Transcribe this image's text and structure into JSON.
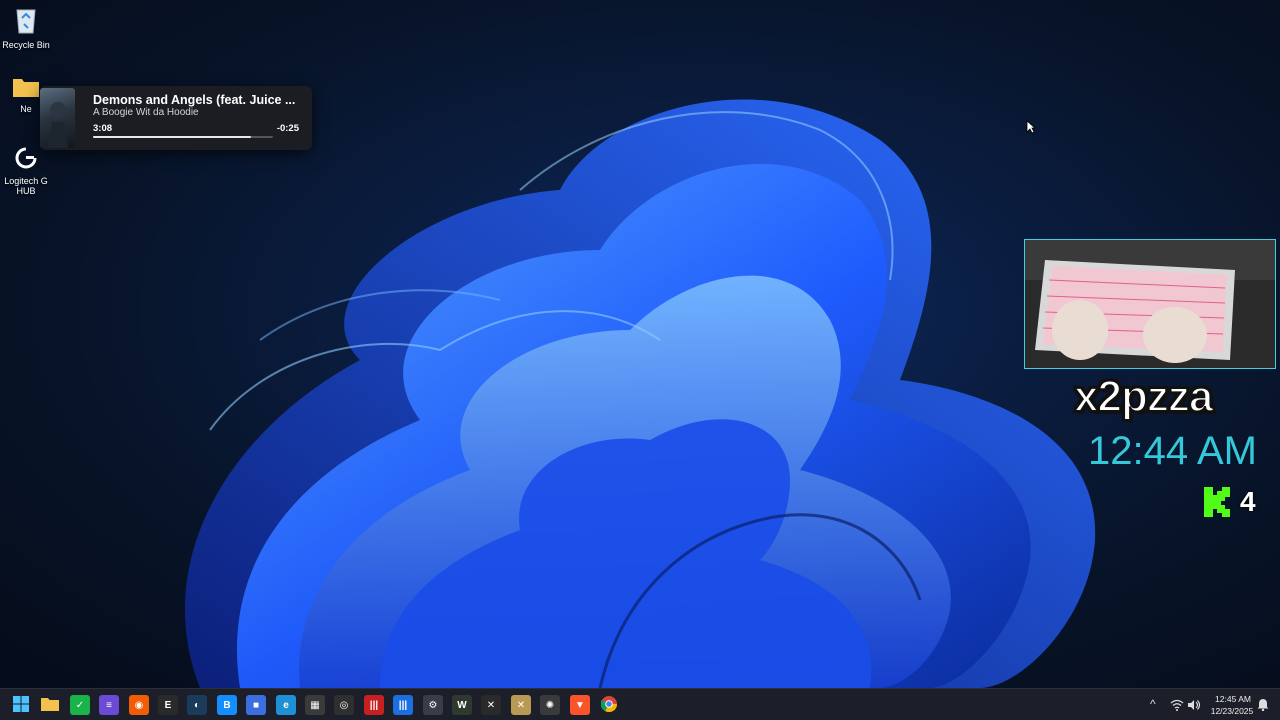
{
  "desktop": {
    "icons": [
      {
        "label": "Recycle Bin",
        "icon": "recycle-bin-icon"
      },
      {
        "label": "Ne",
        "icon": "folder-icon"
      },
      {
        "label": "Logitech G HUB",
        "icon": "logitech-ghub-icon"
      }
    ]
  },
  "media": {
    "title": "Demons and Angels (feat. Juice ...",
    "artist": "A Boogie Wit da Hoodie",
    "elapsed": "3:08",
    "remaining": "-0:25",
    "progress": 0.88
  },
  "overlay": {
    "username": "x2pzza",
    "clock": "12:44 AM",
    "viewer_count": "4",
    "accent": "#35c8d8",
    "kick_color": "#53fc18"
  },
  "taskbar": {
    "apps": [
      {
        "name": "start-button",
        "icon": "windows-logo-icon",
        "color": "#2b8cff",
        "glyph": ""
      },
      {
        "name": "file-explorer-app",
        "icon": "folder-icon",
        "color": "#f2b731",
        "glyph": ""
      },
      {
        "name": "xbox-app",
        "icon": "xbox-icon",
        "color": "#19b34a",
        "glyph": "✓"
      },
      {
        "name": "notes-app",
        "icon": "notes-icon",
        "color": "#6b4bd6",
        "glyph": "≡"
      },
      {
        "name": "origin-app",
        "icon": "origin-icon",
        "color": "#f25c05",
        "glyph": "◉"
      },
      {
        "name": "epic-games-app",
        "icon": "epic-games-icon",
        "color": "#2a2a2a",
        "glyph": "E"
      },
      {
        "name": "steam-app",
        "icon": "steam-icon",
        "color": "#1b3b5a",
        "glyph": "◐"
      },
      {
        "name": "battlenet-app",
        "icon": "battlenet-icon",
        "color": "#148eff",
        "glyph": "B"
      },
      {
        "name": "app-blue-square",
        "icon": "blue-square-icon",
        "color": "#3b6fe0",
        "glyph": "■"
      },
      {
        "name": "edge-app",
        "icon": "edge-icon",
        "color": "#1f8fd6",
        "glyph": "e"
      },
      {
        "name": "minecraft-app",
        "icon": "minecraft-icon",
        "color": "#3a3a3a",
        "glyph": "▦"
      },
      {
        "name": "obs-app",
        "icon": "obs-icon",
        "color": "#2f2f2f",
        "glyph": "◎"
      },
      {
        "name": "app-red-bars",
        "icon": "red-bars-icon",
        "color": "#c62020",
        "glyph": "|||"
      },
      {
        "name": "app-blue-bars",
        "icon": "blue-bars-icon",
        "color": "#1d6ee0",
        "glyph": "|||"
      },
      {
        "name": "settings-app",
        "icon": "gear-icon",
        "color": "#3a3d48",
        "glyph": "⚙"
      },
      {
        "name": "app-w",
        "icon": "w-icon",
        "color": "#2f3a2f",
        "glyph": "W"
      },
      {
        "name": "app-x-dark",
        "icon": "x-icon",
        "color": "#2a2a2a",
        "glyph": "✕"
      },
      {
        "name": "app-x-gold",
        "icon": "x-gold-icon",
        "color": "#b89a55",
        "glyph": "✕"
      },
      {
        "name": "app-sun",
        "icon": "sun-icon",
        "color": "#3a3a3a",
        "glyph": "✺"
      },
      {
        "name": "brave-app",
        "icon": "brave-icon",
        "color": "#fb542b",
        "glyph": "▼"
      },
      {
        "name": "chrome-app",
        "icon": "chrome-icon",
        "color": "#e8e8e8",
        "glyph": ""
      }
    ],
    "tray": {
      "chevron": "^",
      "wifi": "wifi-icon",
      "volume": "volume-icon",
      "time": "12:45 AM",
      "date": "12/23/2025"
    }
  }
}
